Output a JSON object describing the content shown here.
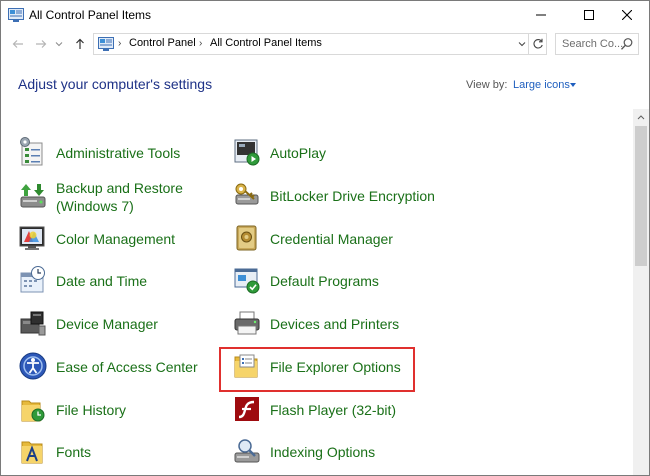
{
  "window": {
    "title": "All Control Panel Items"
  },
  "address": {
    "crumbs": [
      "Control Panel",
      "All Control Panel Items"
    ],
    "search_placeholder": "Search Co..."
  },
  "content": {
    "heading": "Adjust your computer's settings",
    "view_by_label": "View by:",
    "view_by_value": "Large icons"
  },
  "items": {
    "left": [
      {
        "label": "Administrative Tools",
        "icon": "admin-tools-icon"
      },
      {
        "label": "Backup and Restore",
        "label2": "(Windows 7)",
        "icon": "backup-restore-icon"
      },
      {
        "label": "Color Management",
        "icon": "color-management-icon"
      },
      {
        "label": "Date and Time",
        "icon": "date-time-icon"
      },
      {
        "label": "Device Manager",
        "icon": "device-manager-icon"
      },
      {
        "label": "Ease of Access Center",
        "icon": "ease-of-access-icon"
      },
      {
        "label": "File History",
        "icon": "file-history-icon"
      },
      {
        "label": "Fonts",
        "icon": "fonts-icon"
      }
    ],
    "right": [
      {
        "label": "AutoPlay",
        "icon": "autoplay-icon"
      },
      {
        "label": "BitLocker Drive Encryption",
        "icon": "bitlocker-icon"
      },
      {
        "label": "Credential Manager",
        "icon": "credential-manager-icon"
      },
      {
        "label": "Default Programs",
        "icon": "default-programs-icon"
      },
      {
        "label": "Devices and Printers",
        "icon": "devices-printers-icon"
      },
      {
        "label": "File Explorer Options",
        "icon": "file-explorer-options-icon"
      },
      {
        "label": "Flash Player (32-bit)",
        "icon": "flash-player-icon"
      },
      {
        "label": "Indexing Options",
        "icon": "indexing-options-icon"
      }
    ]
  },
  "colors": {
    "link_green": "#1a7018",
    "heading_blue": "#1e3287",
    "highlight_red": "#e0302e"
  }
}
